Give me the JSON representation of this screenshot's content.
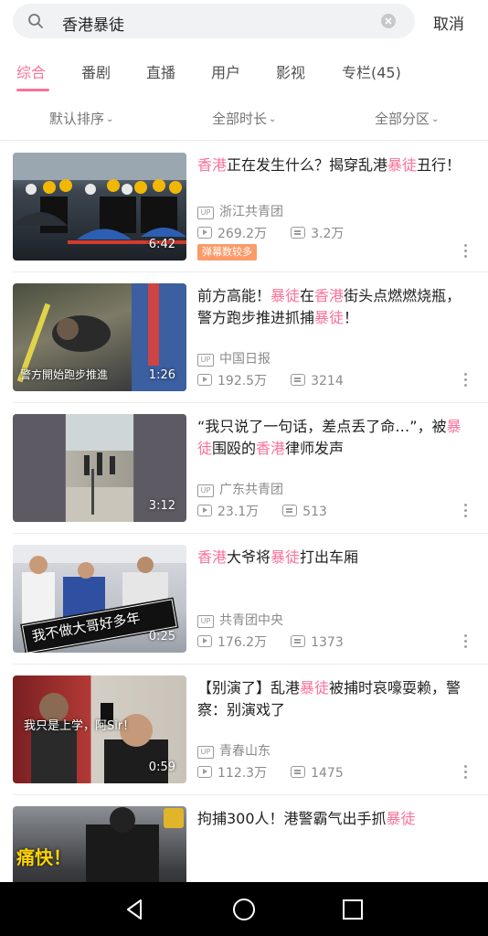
{
  "search": {
    "query": "香港暴徒",
    "cancel_label": "取消",
    "icons": {
      "search": "search-icon",
      "clear": "clear-icon"
    }
  },
  "tabs": [
    {
      "label": "综合",
      "active": true
    },
    {
      "label": "番剧"
    },
    {
      "label": "直播"
    },
    {
      "label": "用户"
    },
    {
      "label": "影视"
    },
    {
      "label": "专栏(45)"
    }
  ],
  "filters": [
    {
      "label": "默认排序"
    },
    {
      "label": "全部时长"
    },
    {
      "label": "全部分区"
    }
  ],
  "results": [
    {
      "title_parts": [
        {
          "text": "香港",
          "hl": true
        },
        {
          "text": "正在发生什么？揭穿乱港"
        },
        {
          "text": "暴徒",
          "hl": true
        },
        {
          "text": "丑行！"
        }
      ],
      "up_name": "浙江共青团",
      "views": "269.2万",
      "danmaku": "3.2万",
      "duration": "6:42",
      "tag": "弹幕数较多"
    },
    {
      "title_parts": [
        {
          "text": "前方高能！"
        },
        {
          "text": "暴徒",
          "hl": true
        },
        {
          "text": "在"
        },
        {
          "text": "香港",
          "hl": true
        },
        {
          "text": "街头点燃燃烧瓶，警方跑步推进抓捕"
        },
        {
          "text": "暴徒",
          "hl": true
        },
        {
          "text": "！"
        }
      ],
      "up_name": "中国日报",
      "views": "192.5万",
      "danmaku": "3214",
      "duration": "1:26",
      "caption": "警方開始跑步推進"
    },
    {
      "title_parts": [
        {
          "text": "“我只说了一句话，差点丢了命…”，被"
        },
        {
          "text": "暴徒",
          "hl": true
        },
        {
          "text": "围殴的"
        },
        {
          "text": "香港",
          "hl": true
        },
        {
          "text": "律师发声"
        }
      ],
      "up_name": "广东共青团",
      "views": "23.1万",
      "danmaku": "513",
      "duration": "3:12"
    },
    {
      "title_parts": [
        {
          "text": "香港",
          "hl": true
        },
        {
          "text": "大爷将"
        },
        {
          "text": "暴徒",
          "hl": true
        },
        {
          "text": "打出车厢"
        }
      ],
      "up_name": "共青团中央",
      "views": "176.2万",
      "danmaku": "1373",
      "duration": "0:25",
      "caption": "我不做大哥好多年"
    },
    {
      "title_parts": [
        {
          "text": "【别演了】乱港"
        },
        {
          "text": "暴徒",
          "hl": true
        },
        {
          "text": "被捕时哀嚎耍赖，警察：别演戏了"
        }
      ],
      "up_name": "青春山东",
      "views": "112.3万",
      "danmaku": "1475",
      "duration": "0:59",
      "caption": "我只是上学，阿Sir！"
    },
    {
      "title_parts": [
        {
          "text": "拘捕300人！港警霸气出手抓"
        },
        {
          "text": "暴徒",
          "hl": true
        }
      ],
      "up_name": "",
      "views": "",
      "danmaku": "",
      "duration": "",
      "caption": "痛快！"
    }
  ],
  "colors": {
    "accent": "#fb7299",
    "tag_bg": "#fb9b6a",
    "muted": "#8a8a8a"
  },
  "navbar": {
    "icons": [
      "back-icon",
      "home-icon",
      "recents-icon"
    ]
  }
}
